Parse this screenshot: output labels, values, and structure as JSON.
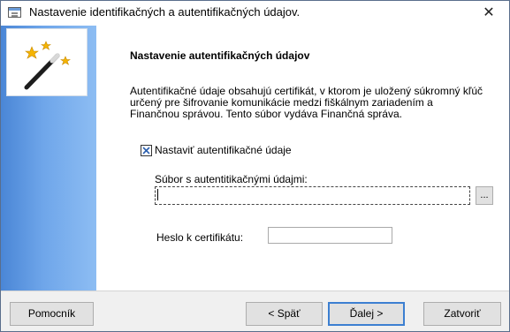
{
  "window": {
    "title": "Nastavenie identifikačných a autentifikačných údajov."
  },
  "titlebar": {
    "close_glyph": "✕"
  },
  "page": {
    "heading": "Nastavenie autentifikačných údajov",
    "description": "Autentifikačné údaje obsahujú certifikát, v ktorom je uložený súkromný kľúč určený pre šifrovanie komunikácie medzi fiškálnym zariadením a Finančnou správou. Tento súbor vydáva Finančná správa.",
    "checkbox_label": "Nastaviť autentifikačné údaje",
    "checkbox_checked": true,
    "file_label": "Súbor s autentitikačnými údajmi:",
    "file_value": "",
    "browse_label": "...",
    "password_label": "Heslo k certifikátu:",
    "password_value": ""
  },
  "buttons": {
    "help": "Pomocník",
    "back": "< Späť",
    "next": "Ďalej >",
    "close": "Zatvoriť"
  },
  "icons": {
    "app": "window-app-icon",
    "wizard": "magic-wand-icon"
  },
  "colors": {
    "sidebar_gradient_start": "#4a86d6",
    "sidebar_gradient_end": "#8dbdf3",
    "default_button_border": "#3c7fd1",
    "star": "#f5b400"
  }
}
